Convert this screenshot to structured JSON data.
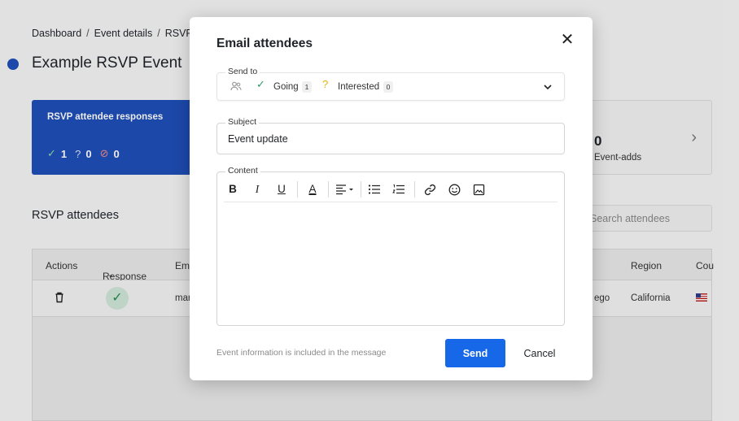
{
  "breadcrumb": {
    "items": [
      "Dashboard",
      "Event details",
      "RSVP"
    ]
  },
  "page": {
    "title": "Example RSVP Event"
  },
  "rsvp_card": {
    "title": "RSVP attendee responses",
    "going_count": "1",
    "interested_count": "0",
    "declined_count": "0"
  },
  "event_adds_card": {
    "value": "0",
    "label": "Event-adds"
  },
  "attendees": {
    "title": "RSVP attendees",
    "search_placeholder": "Search attendees",
    "columns": {
      "actions": "Actions",
      "response": "Response",
      "email": "Ema",
      "region": "Region",
      "country": "Cou"
    },
    "row": {
      "email": "mar",
      "city": "ego",
      "region": "California"
    }
  },
  "modal": {
    "title": "Email attendees",
    "send_to": {
      "label": "Send to",
      "going_label": "Going",
      "going_count": "1",
      "interested_label": "Interested",
      "interested_count": "0"
    },
    "subject": {
      "label": "Subject",
      "value": "Event update"
    },
    "content": {
      "label": "Content"
    },
    "toolbar": {
      "bold": "B",
      "italic": "I",
      "underline": "U",
      "font_color": "A"
    },
    "footnote": "Event information is included in the message",
    "send_label": "Send",
    "cancel_label": "Cancel"
  },
  "colors": {
    "accent": "#1668e8",
    "card_blue": "#1f4fb8",
    "going_green": "#2a9d68",
    "interested_yellow": "#e8b10e",
    "declined_red": "#e06a6a"
  }
}
